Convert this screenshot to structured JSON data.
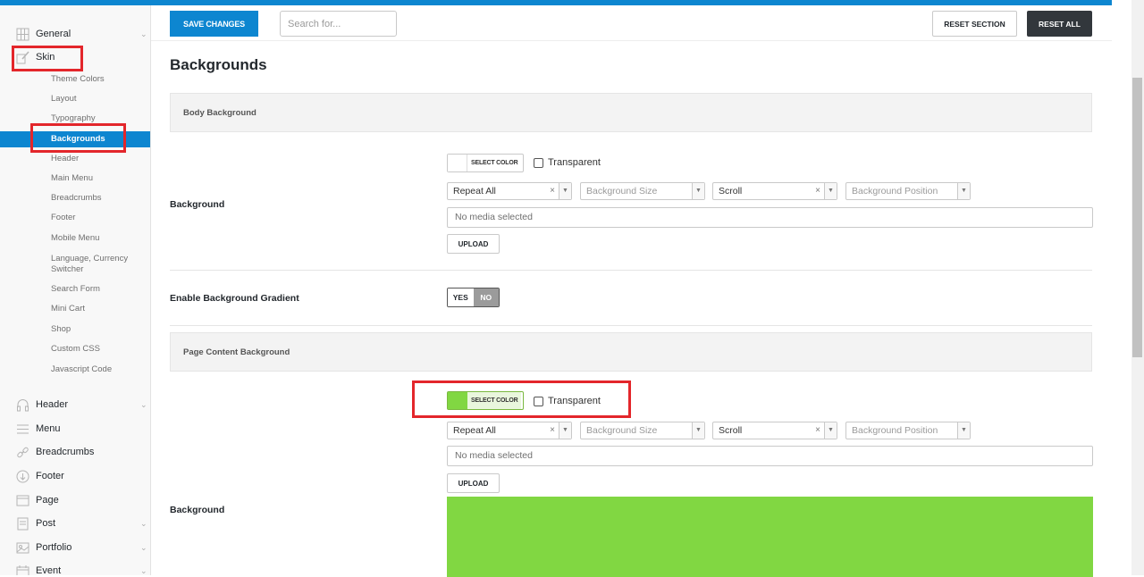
{
  "sidebar": {
    "sections": [
      {
        "label": "General",
        "icon": "grid-icon",
        "chevron": "⌄"
      },
      {
        "label": "Skin",
        "icon": "brush-icon"
      },
      {
        "label": "Header",
        "icon": "headphones-icon",
        "chevron": "⌄"
      },
      {
        "label": "Menu",
        "icon": "menu-icon"
      },
      {
        "label": "Breadcrumbs",
        "icon": "link-icon"
      },
      {
        "label": "Footer",
        "icon": "download-circle-icon"
      },
      {
        "label": "Page",
        "icon": "page-icon"
      },
      {
        "label": "Post",
        "icon": "post-icon",
        "chevron": "⌄"
      },
      {
        "label": "Portfolio",
        "icon": "image-icon",
        "chevron": "⌄"
      },
      {
        "label": "Event",
        "icon": "calendar-icon",
        "chevron": "⌄"
      }
    ],
    "skin_items": [
      "Theme Colors",
      "Layout",
      "Typography",
      "Backgrounds",
      "Header",
      "Main Menu",
      "Breadcrumbs",
      "Footer",
      "Mobile Menu",
      "Language, Currency",
      "Switcher",
      "Search Form",
      "Mini Cart",
      "Shop",
      "Custom CSS",
      "Javascript Code"
    ]
  },
  "toolbar": {
    "save_label": "SAVE CHANGES",
    "search_placeholder": "Search for...",
    "reset_section_label": "RESET SECTION",
    "reset_all_label": "RESET ALL"
  },
  "page": {
    "title": "Backgrounds",
    "body_section": {
      "header": "Body Background",
      "background_label": "Background",
      "select_color_label": "SELECT COLOR",
      "swatch_color": "#ffffff",
      "transparent_label": "Transparent",
      "repeat": "Repeat All",
      "size_placeholder": "Background Size",
      "attachment": "Scroll",
      "position_placeholder": "Background Position",
      "media_text": "No media selected",
      "upload_label": "UPLOAD"
    },
    "gradient": {
      "label": "Enable Background Gradient",
      "yes": "YES",
      "no": "NO"
    },
    "content_section": {
      "header": "Page Content Background",
      "background_label": "Background",
      "select_color_label": "SELECT COLOR",
      "swatch_color": "#81d742",
      "transparent_label": "Transparent",
      "repeat": "Repeat All",
      "size_placeholder": "Background Size",
      "attachment": "Scroll",
      "position_placeholder": "Background Position",
      "media_text": "No media selected",
      "upload_label": "UPLOAD"
    }
  },
  "colors": {
    "accent": "#0d86d0",
    "dark_button": "#32373c",
    "highlight": "#e3262b",
    "preview_green": "#81d742"
  }
}
